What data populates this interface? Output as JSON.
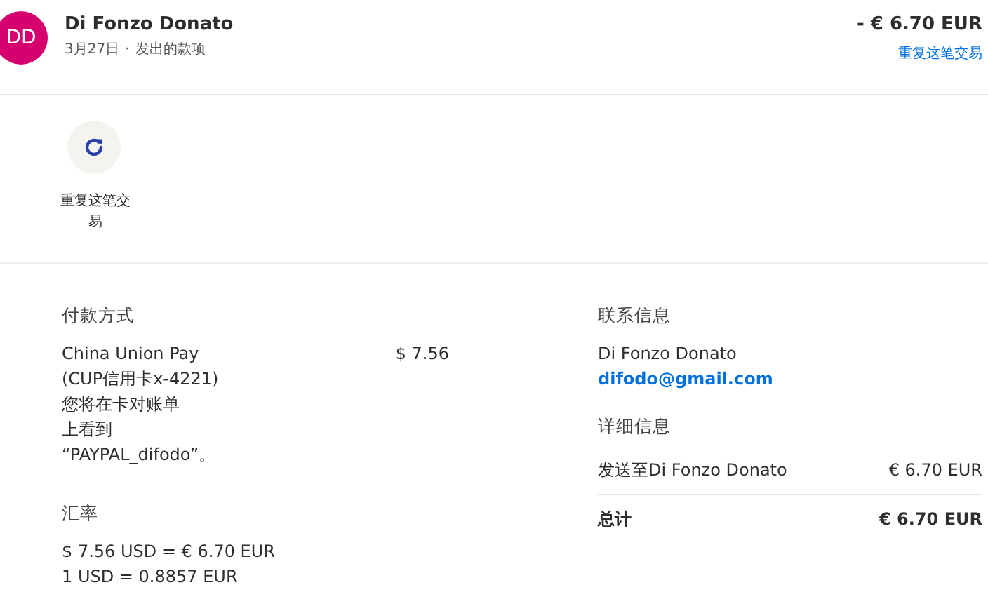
{
  "header": {
    "avatar": "DD",
    "name": "Di Fonzo Donato",
    "date": "3月27日",
    "separator": "·",
    "type": "发出的款项",
    "amount": "- € 6.70 EUR",
    "repeat_link": "重复这笔交易"
  },
  "actions": [
    {
      "label_lines": [
        "重复这笔交",
        "易"
      ]
    }
  ],
  "payment": {
    "heading": "付款方式",
    "lines": [
      "China Union Pay",
      "(CUP信用卡x-4221)",
      "您将在卡对账单",
      "上看到",
      "“PAYPAL_difodo”。"
    ],
    "amount": "$ 7.56"
  },
  "exchange": {
    "heading": "汇率",
    "lines": [
      "$ 7.56 USD = € 6.70 EUR",
      "1 USD = 0.8857 EUR"
    ]
  },
  "contact": {
    "heading": "联系信息",
    "name": "Di Fonzo Donato",
    "email": "difodo@gmail.com"
  },
  "details": {
    "heading": "详细信息",
    "rows": [
      {
        "label": "发送至Di Fonzo Donato",
        "value": "€ 6.70 EUR",
        "kind": "item"
      },
      {
        "label": "总计",
        "value": "€ 6.70 EUR",
        "kind": "total"
      }
    ]
  }
}
